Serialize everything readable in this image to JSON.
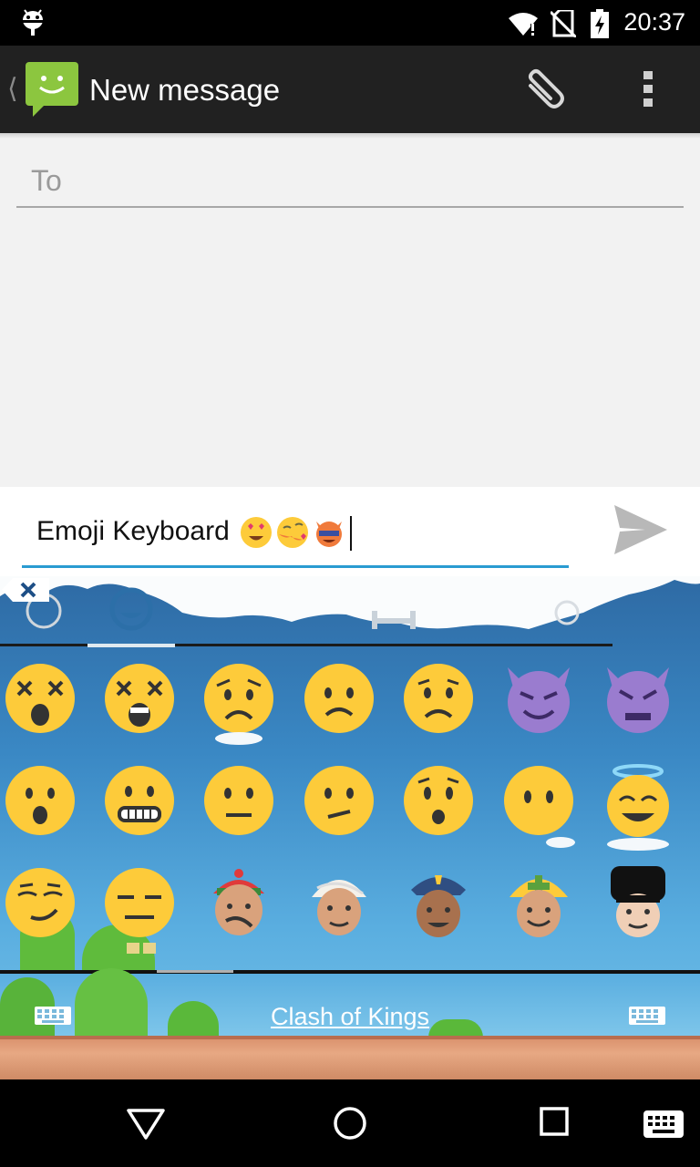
{
  "status_bar": {
    "time": "20:37",
    "icons": [
      "android-debug-icon",
      "wifi-icon",
      "no-sim-icon",
      "battery-charging-icon"
    ]
  },
  "action_bar": {
    "title": "New message",
    "back_icon": "chevron-left-icon",
    "app_icon": "messaging-app-icon",
    "actions": [
      "attach-icon",
      "overflow-menu-icon"
    ]
  },
  "recipient": {
    "placeholder": "To",
    "value": ""
  },
  "compose": {
    "text": "Emoji Keyboard",
    "inserted_emojis": [
      "smiling face with heart eyes",
      "face throwing kiss",
      "imp face"
    ],
    "send_icon": "send-icon"
  },
  "emoji_keyboard": {
    "categories": [
      "recent-icon",
      "smileys-icon",
      "objects-icon",
      "nature-icon"
    ],
    "active_category": "smileys",
    "backspace_icon": "backspace-icon",
    "emoji_rows": [
      [
        "dizzy face",
        "dizzy face open mouth",
        "worried face",
        "frowning face",
        "confused face",
        "smiling imp",
        "angry imp"
      ],
      [
        "hushed face",
        "grimacing face",
        "neutral face",
        "confused face",
        "astonished face",
        "face without mouth",
        "smiling face with halo"
      ],
      [
        "smirking face",
        "expressionless face",
        "man with gua pi mao",
        "man with turban",
        "police officer",
        "construction worker",
        "guardsman"
      ]
    ],
    "ad_text": "Clash of Kings",
    "left_keyboard_icon": "keyboard-icon",
    "right_keyboard_icon": "keyboard-icon"
  },
  "nav_bar": {
    "buttons": [
      "back-icon",
      "home-icon",
      "recents-icon",
      "keyboard-switch-icon"
    ]
  },
  "colors": {
    "accent": "#2a9bd1",
    "action_bar": "#212121",
    "emoji_yellow": "#fdcb3a",
    "imp_purple": "#9a7ccf"
  }
}
